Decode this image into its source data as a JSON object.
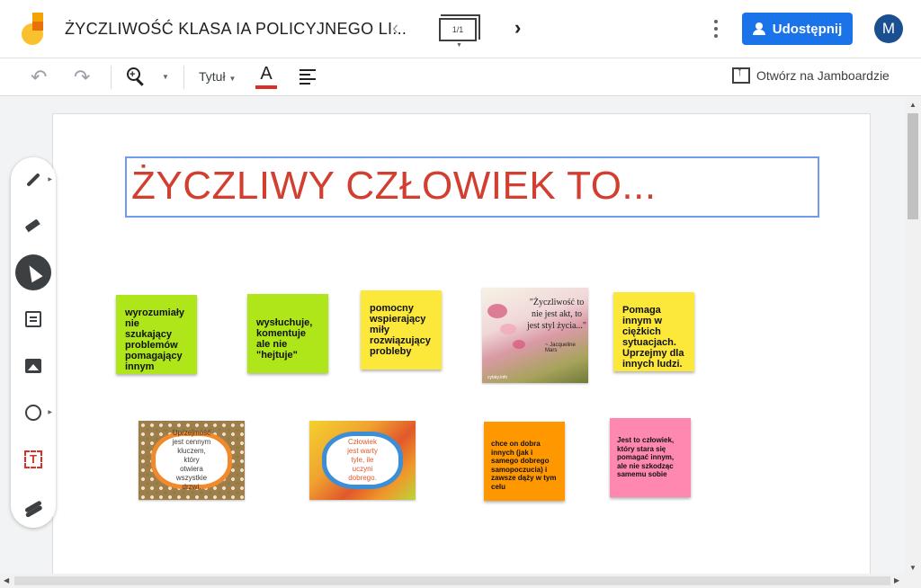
{
  "header": {
    "title": "ŻYCZLIWOŚĆ KLASA IA POLICYJNEGO LI...",
    "frame_counter": "1/1",
    "share_label": "Udostępnij",
    "avatar_letter": "M",
    "share_color": "#1a73e8"
  },
  "toolbar": {
    "font_label": "Tytuł",
    "open_label": "Otwórz na Jamboardzie",
    "text_color": "#d93025",
    "icons": [
      "undo-icon",
      "redo-icon",
      "zoom-icon",
      "text-color-icon",
      "align-icon",
      "open-in-jamboard-icon"
    ]
  },
  "board": {
    "title": "ŻYCZLIWY CZŁOWIEK TO...",
    "title_color": "#d23f31",
    "notes": [
      {
        "text": "wyrozumiały nie szukający problemów pomagający innym",
        "color": "#aee61a"
      },
      {
        "text": "wysłuchuje, komentuje ale nie \"hejtuje\"",
        "color": "#aee61a"
      },
      {
        "text": "pomocny wspierający miły rozwiązujący probleby",
        "color": "#fce83a"
      },
      {
        "text": "Pomaga innym w ciężkich sytuacjach. Uprzejmy dla innych ludzi.",
        "color": "#fce83a"
      },
      {
        "text": "chce on dobra innych (jak i samego dobrego samopoczucia) i zawsze dąży w tym celu",
        "color": "#ff9800"
      },
      {
        "text": "Jest to człowiek, który stara się pomagać innym, ale nie szkodząc samemu sobie",
        "color": "#ff88b0"
      }
    ],
    "images": {
      "flower_quote": "\"Życzliwość to nie jest akt, to jest styl życia...\"",
      "flower_author": "~ Jacqueline Mars",
      "flower_sig": "cytaty.info",
      "frame1_text": "Uprzejmość jest cennym kluczem, który otwiera wszystkie drzwi.",
      "frame2_text": "Człowiek jest warty tyle, ile uczyni dobrego."
    }
  },
  "palette": {
    "tools": [
      "pen-icon",
      "eraser-icon",
      "select-icon",
      "sticky-note-icon",
      "image-icon",
      "circle-icon",
      "text-box-icon",
      "laser-icon"
    ]
  }
}
